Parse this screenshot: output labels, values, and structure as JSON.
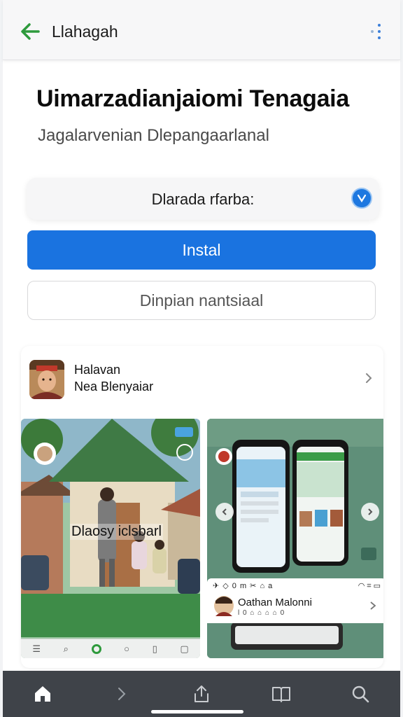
{
  "appbar": {
    "title": "Llahagah",
    "back_icon": "arrow-left-icon",
    "menu_icon": "more-vertical-icon",
    "accent_color": "#2e9a3c"
  },
  "header": {
    "title": "Uimarzadianjaiomi Tenagaia",
    "subtitle": "Jagalarvenian Dlepangaarlanal"
  },
  "selector": {
    "label": "Dlarada rfarba:",
    "badge_icon": "check-circle-icon"
  },
  "actions": {
    "install_label": "Instal",
    "secondary_label": "Dinpian nantsiaal",
    "primary_color": "#1a73e0"
  },
  "author": {
    "name": "Halavan",
    "subtitle": "Nea Blenyaiar"
  },
  "screenshots": {
    "left_caption": "Dlaosy iclsbarl",
    "right_card": {
      "status_left": "✈ ◇ 0 m ✂ ⌂ a",
      "status_right": "◠ ⌗ ▭",
      "name": "Oathan Malonni",
      "sub": "l 0 ⌂ ⌂ ⌂ ⌂ 0"
    }
  },
  "bottom_nav": {
    "items": [
      "home-icon",
      "chevron-right-icon",
      "share-icon",
      "book-icon",
      "search-icon"
    ]
  }
}
